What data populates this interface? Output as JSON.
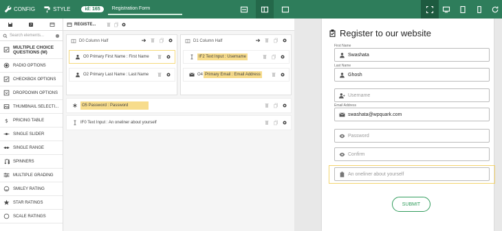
{
  "topbar": {
    "config_label": "CONFIG",
    "style_label": "STYLE",
    "form_id": "id: 165",
    "form_name": "Registration Form"
  },
  "sidebar": {
    "search_placeholder": "Search elements...",
    "items": [
      {
        "label": "MULTIPLE CHOICE QUESTIONS (M)",
        "icon": "checkbox-checked-icon"
      },
      {
        "label": "RADIO OPTIONS",
        "icon": "radio-icon"
      },
      {
        "label": "CHECKBOX OPTIONS",
        "icon": "checkbox-icon"
      },
      {
        "label": "DROPDOWN OPTIONS",
        "icon": "dropdown-icon"
      },
      {
        "label": "THUMBNAIL SELECTI...",
        "icon": "image-icon"
      },
      {
        "label": "PRICING TABLE",
        "icon": "dollar-icon"
      },
      {
        "label": "SINGLE SLIDER",
        "icon": "slider-icon"
      },
      {
        "label": "SINGLE RANGE",
        "icon": "range-icon"
      },
      {
        "label": "SPINNERS",
        "icon": "spinner-icon"
      },
      {
        "label": "MULTIPLE GRADING",
        "icon": "grading-icon"
      },
      {
        "label": "SMILEY RATING",
        "icon": "smiley-icon"
      },
      {
        "label": "STAR RATINGS",
        "icon": "star-icon"
      },
      {
        "label": "SCALE RATINGS",
        "icon": "scale-icon"
      }
    ]
  },
  "canvas": {
    "tab_label": "REGISTE...",
    "col1_title": "D0 Column Half",
    "col2_title": "D1 Column Half",
    "fields": {
      "first_name_code": "O0 Primary First Name : First Name",
      "last_name_code": "O2 Primary Last Name : Last Name",
      "username_code": "IF2 Text Input : Username",
      "email_prefix": "O4",
      "email_tag": "Primary Email : Email Address",
      "password_tag": "O5 Password : Password",
      "about_code": "IF0 Text Input : An oneliner about yourself"
    }
  },
  "preview": {
    "title": "Register to our website",
    "first_name_label": "First Name",
    "first_name_value": "Swashata",
    "last_name_label": "Last Name",
    "last_name_value": "Ghosh",
    "username_placeholder": "Username",
    "email_label": "Email Address",
    "email_value": "swashata@wpquark.com",
    "password_placeholder": "Password",
    "confirm_placeholder": "Confirm",
    "about_placeholder": "An oneliner about yourself",
    "submit_label": "SUBMIT"
  },
  "colors": {
    "brand": "#2e7d5b",
    "highlight": "#f7dc8c",
    "submit": "#2e9b5a"
  }
}
